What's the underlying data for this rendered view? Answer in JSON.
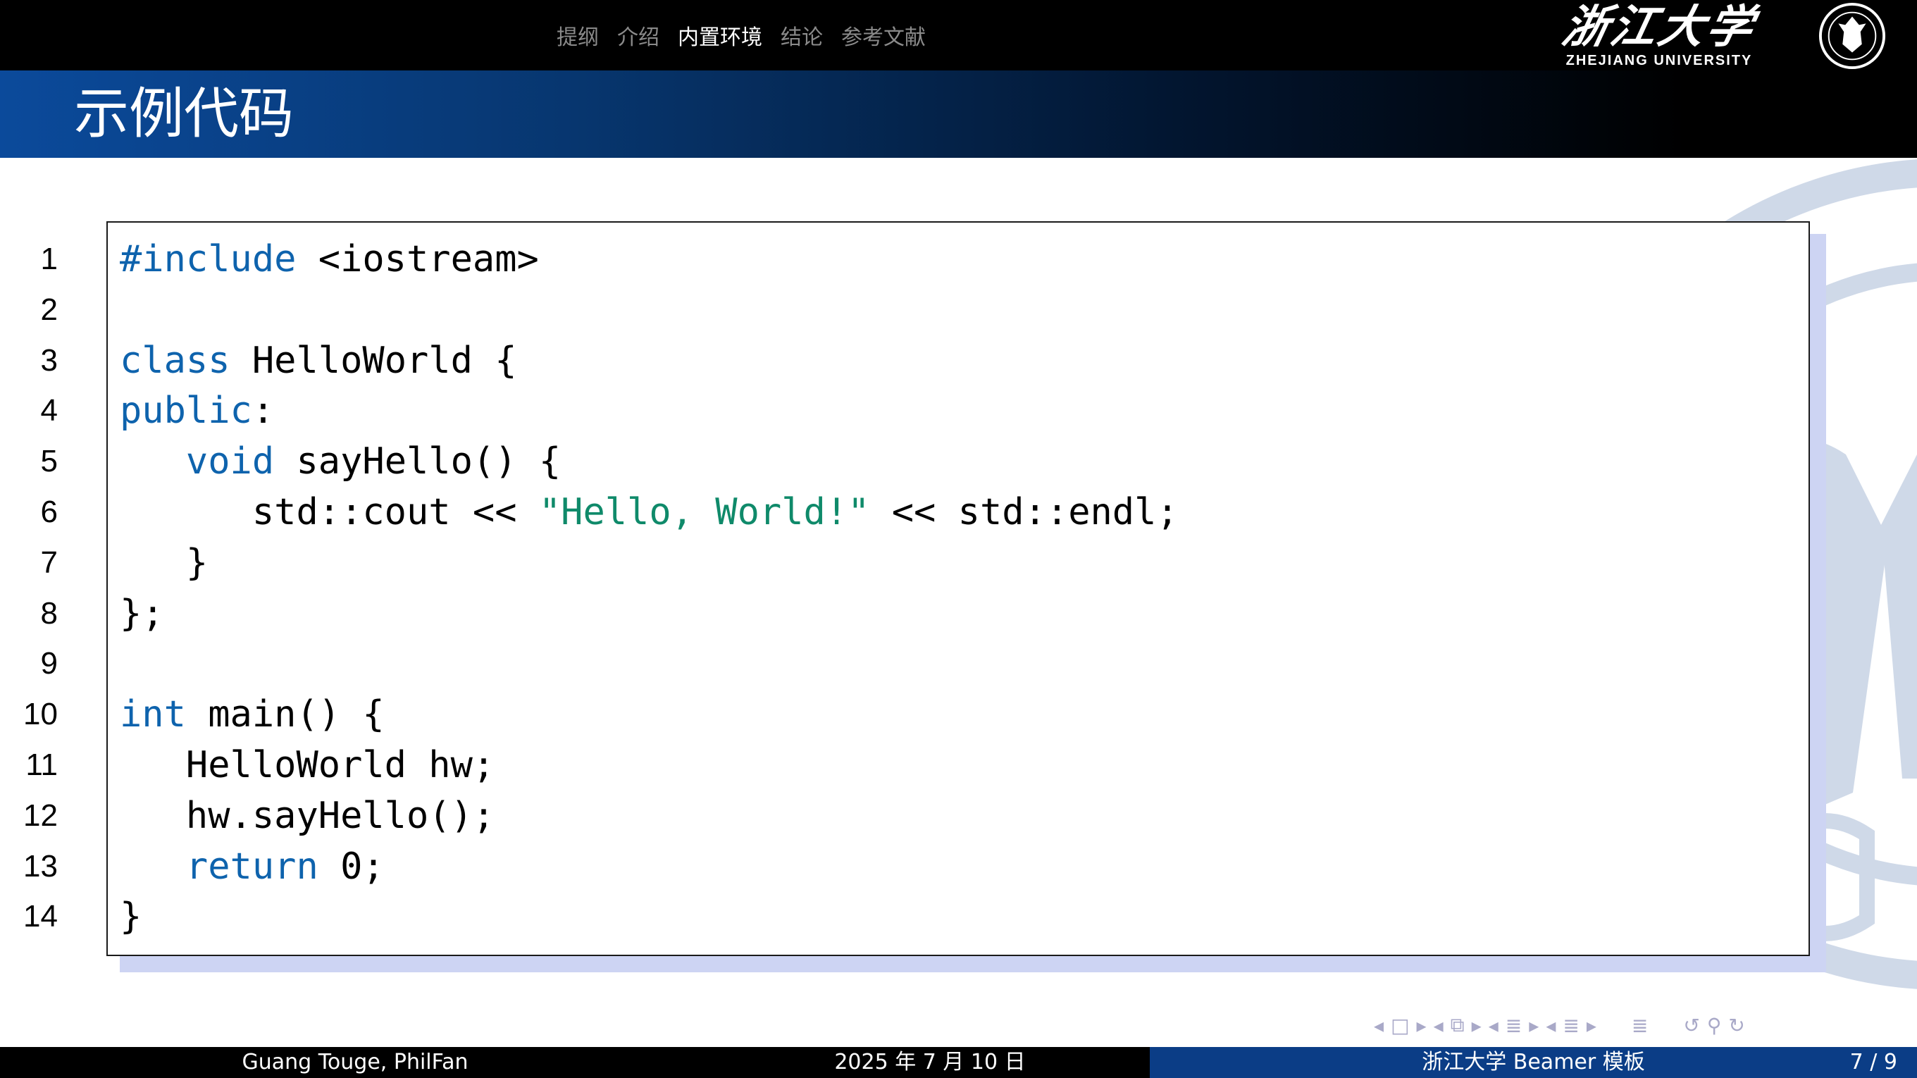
{
  "header": {
    "nav_sections": [
      "提纲",
      "介绍",
      "内置环境",
      "结论",
      "参考文献"
    ],
    "active_section": "内置环境",
    "logo_calligraphy": "浙江大学",
    "logo_english": "ZHEJIANG UNIVERSITY"
  },
  "frame": {
    "title": "示例代码"
  },
  "code": {
    "line_numbers": [
      "1",
      "2",
      "3",
      "4",
      "5",
      "6",
      "7",
      "8",
      "9",
      "10",
      "11",
      "12",
      "13",
      "14"
    ],
    "lines": [
      [
        {
          "t": "#include",
          "c": "kw"
        },
        {
          "t": " <iostream>",
          "c": ""
        }
      ],
      [],
      [
        {
          "t": "class",
          "c": "kw"
        },
        {
          "t": " HelloWorld {",
          "c": ""
        }
      ],
      [
        {
          "t": "public",
          "c": "kw"
        },
        {
          "t": ":",
          "c": ""
        }
      ],
      [
        {
          "t": "   ",
          "c": ""
        },
        {
          "t": "void",
          "c": "kw"
        },
        {
          "t": " sayHello() {",
          "c": ""
        }
      ],
      [
        {
          "t": "      std::cout << ",
          "c": ""
        },
        {
          "t": "\"Hello, World!\"",
          "c": "str"
        },
        {
          "t": " << std::endl;",
          "c": ""
        }
      ],
      [
        {
          "t": "   }",
          "c": ""
        }
      ],
      [
        {
          "t": "};",
          "c": ""
        }
      ],
      [],
      [
        {
          "t": "int",
          "c": "kw"
        },
        {
          "t": " main() {",
          "c": ""
        }
      ],
      [
        {
          "t": "   HelloWorld hw;",
          "c": ""
        }
      ],
      [
        {
          "t": "   hw.sayHello();",
          "c": ""
        }
      ],
      [
        {
          "t": "   ",
          "c": ""
        },
        {
          "t": "return",
          "c": "kw"
        },
        {
          "t": " 0;",
          "c": ""
        }
      ],
      [
        {
          "t": "}",
          "c": ""
        }
      ]
    ]
  },
  "colors": {
    "keyword": "#0e63ad",
    "string": "#0f8a6a",
    "frame_shadow": "#cdd4f3",
    "footer_blue": "#0b3d86"
  },
  "footer": {
    "authors": "Guang Touge, PhilFan",
    "date": "2025 年 7 月 10 日",
    "title": "浙江大学 Beamer 模板",
    "page": "7 / 9"
  }
}
